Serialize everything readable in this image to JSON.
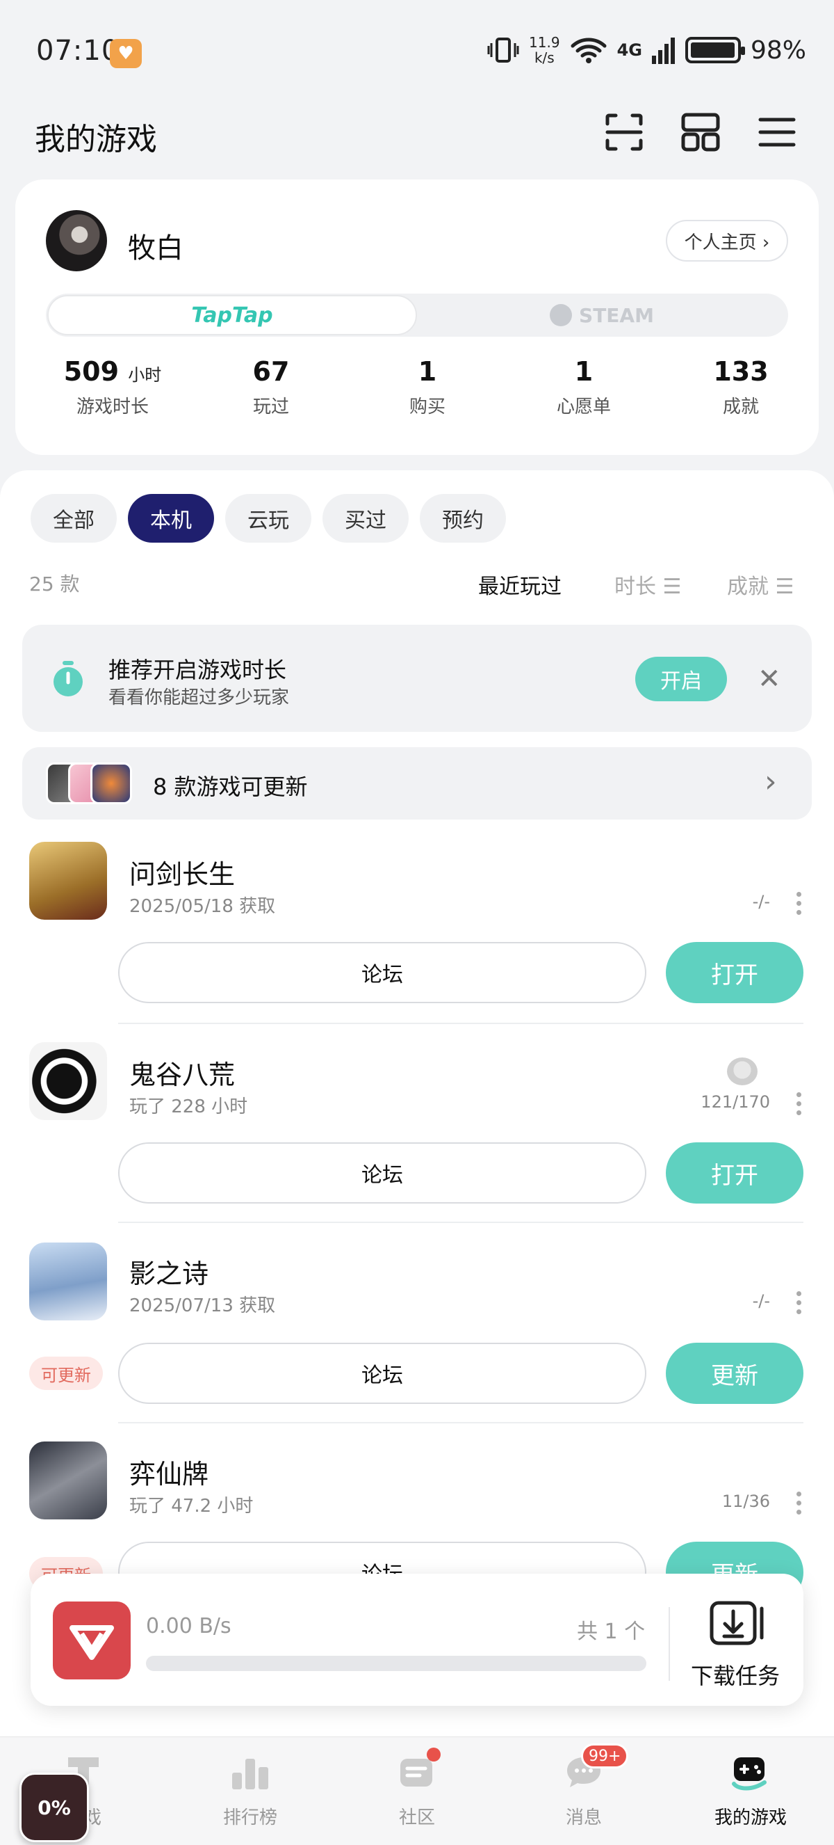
{
  "status_bar": {
    "time": "07:10",
    "net_speed_value": "11.9",
    "net_speed_unit": "k/s",
    "network_type": "4G",
    "battery": "98%"
  },
  "header": {
    "title": "我的游戏"
  },
  "profile": {
    "name": "牧白",
    "profile_link": "个人主页 ›",
    "platforms": [
      "TapTap",
      "STEAM"
    ],
    "stats": [
      {
        "value": "509",
        "unit": "小时",
        "label": "游戏时长"
      },
      {
        "value": "67",
        "unit": "",
        "label": "玩过"
      },
      {
        "value": "1",
        "unit": "",
        "label": "购买"
      },
      {
        "value": "1",
        "unit": "",
        "label": "心愿单"
      },
      {
        "value": "133",
        "unit": "",
        "label": "成就"
      }
    ]
  },
  "filters": [
    "全部",
    "本机",
    "云玩",
    "买过",
    "预约"
  ],
  "active_filter": "本机",
  "list_count": "25 款",
  "sort_options": [
    "最近玩过",
    "时长 ☰",
    "成就 ☰"
  ],
  "recommend": {
    "title": "推荐开启游戏时长",
    "subtitle": "看看你能超过多少玩家",
    "button": "开启"
  },
  "updates_banner": {
    "text": "8 款游戏可更新"
  },
  "games": [
    {
      "name": "问剑长生",
      "meta": "2025/05/18 获取",
      "progress": "-/-",
      "forum": "论坛",
      "action": "打开",
      "tag": ""
    },
    {
      "name": "鬼谷八荒",
      "meta": "玩了 228 小时",
      "progress": "121/170",
      "forum": "论坛",
      "action": "打开",
      "tag": ""
    },
    {
      "name": "影之诗",
      "meta": "2025/07/13 获取",
      "progress": "-/-",
      "forum": "论坛",
      "action": "更新",
      "tag": "可更新"
    },
    {
      "name": "弈仙牌",
      "meta": "玩了 47.2 小时",
      "progress": "11/36",
      "forum": "论坛",
      "action": "更新",
      "tag": "可更新"
    }
  ],
  "download": {
    "speed": "0.00 B/s",
    "count": "共 1 个",
    "task_label": "下载任务",
    "progress_fraction": 0
  },
  "bottom_nav": [
    {
      "label": "游戏"
    },
    {
      "label": "排行榜"
    },
    {
      "label": "社区"
    },
    {
      "label": "消息",
      "badge": "99+"
    },
    {
      "label": "我的游戏"
    }
  ],
  "floating_widget": {
    "percent": "0%"
  },
  "colors": {
    "accent": "#5fd1c0",
    "active_chip": "#1f1f6e",
    "update_tag": "#e26a5e",
    "badge": "#e8524a"
  }
}
